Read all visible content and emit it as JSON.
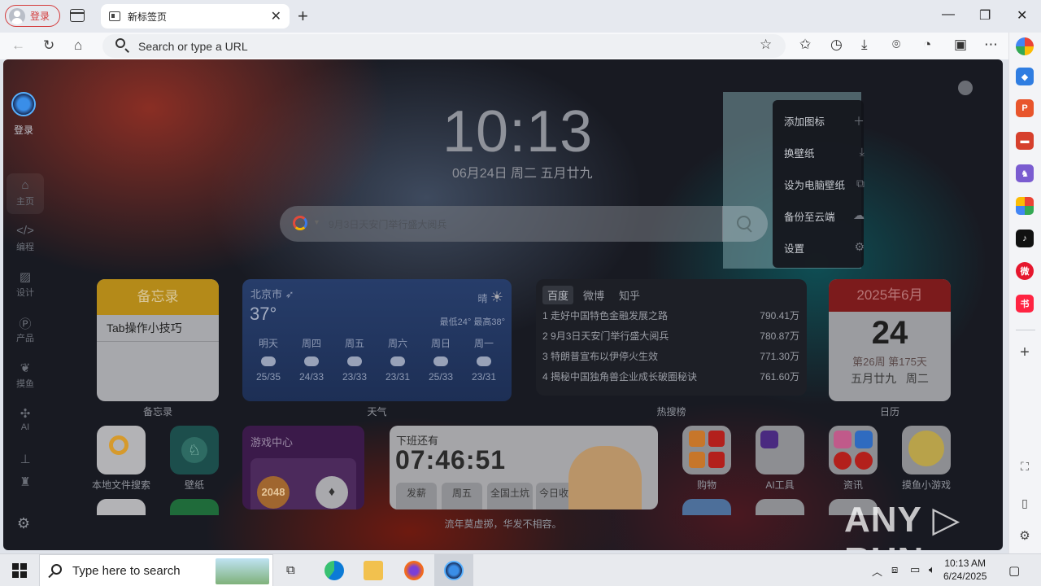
{
  "browser": {
    "profile_label": "登录",
    "tab_title": "新标签页",
    "address_placeholder": "Search  or type a URL"
  },
  "sidebar": {
    "login_label": "登录",
    "items": [
      {
        "icon": "home-icon",
        "label": "主页"
      },
      {
        "icon": "code-icon",
        "label": "编程"
      },
      {
        "icon": "image-icon",
        "label": "设计"
      },
      {
        "icon": "product-icon",
        "label": "产品"
      },
      {
        "icon": "leaf-icon",
        "label": "摸鱼"
      },
      {
        "icon": "ai-icon",
        "label": "AI"
      }
    ]
  },
  "clock": {
    "time": "10:13",
    "date": "06月24日 周二 五月廿九"
  },
  "search": {
    "placeholder": "9月3日天安门举行盛大阅兵"
  },
  "context_menu": {
    "items": [
      {
        "label": "添加图标",
        "icon": "plus-icon"
      },
      {
        "label": "换壁纸",
        "icon": "download-icon"
      },
      {
        "label": "设为电脑壁纸",
        "icon": "wallpaper-icon"
      },
      {
        "label": "备份至云端",
        "icon": "cloud-icon"
      },
      {
        "label": "设置",
        "icon": "gear-icon"
      }
    ]
  },
  "memo": {
    "title": "备忘录",
    "item": "Tab操作小技巧",
    "label": "备忘录"
  },
  "weather": {
    "city": "北京市",
    "temp": "37°",
    "condition": "晴",
    "range": "最低24° 最高38°",
    "label": "天气",
    "days": [
      {
        "name": "明天",
        "range": "25/35"
      },
      {
        "name": "周四",
        "range": "24/33"
      },
      {
        "name": "周五",
        "range": "23/33"
      },
      {
        "name": "周六",
        "range": "23/31"
      },
      {
        "name": "周日",
        "range": "25/33"
      },
      {
        "name": "周一",
        "range": "23/31"
      }
    ]
  },
  "hot": {
    "tabs": [
      "百度",
      "微博",
      "知乎"
    ],
    "label": "热搜榜",
    "rows": [
      {
        "rank": "1",
        "title": "走好中国特色金融发展之路",
        "value": "790.41万"
      },
      {
        "rank": "2",
        "title": "9月3日天安门举行盛大阅兵",
        "value": "780.87万"
      },
      {
        "rank": "3",
        "title": "特朗普宣布以伊停火生效",
        "value": "771.30万"
      },
      {
        "rank": "4",
        "title": "揭秘中国独角兽企业成长破圈秘诀",
        "value": "761.60万"
      }
    ]
  },
  "calendar": {
    "month": "2025年6月",
    "day": "24",
    "week": "第26周 第175天",
    "lunar": "五月廿九",
    "weekday": "周二",
    "label": "日历"
  },
  "tiles": {
    "local_search": "本地文件搜索",
    "wallpaper": "壁纸",
    "shopping": "购物",
    "ai_tools": "AI工具",
    "news": "资讯",
    "games_small": "摸鱼小游戏"
  },
  "games": {
    "title": "游戏中心",
    "game1": "2048"
  },
  "offwork": {
    "title": "下班还有",
    "countdown": "07:46:51",
    "cells": [
      "发薪",
      "周五",
      "全国土炕",
      "今日收入"
    ]
  },
  "footer": {
    "slogan": "流年莫虚掷，华发不相容。"
  },
  "watermark": "ANY ▷ RUN",
  "taskbar": {
    "search_placeholder": "Type here to search",
    "time": "10:13 AM",
    "date": "6/24/2025"
  }
}
